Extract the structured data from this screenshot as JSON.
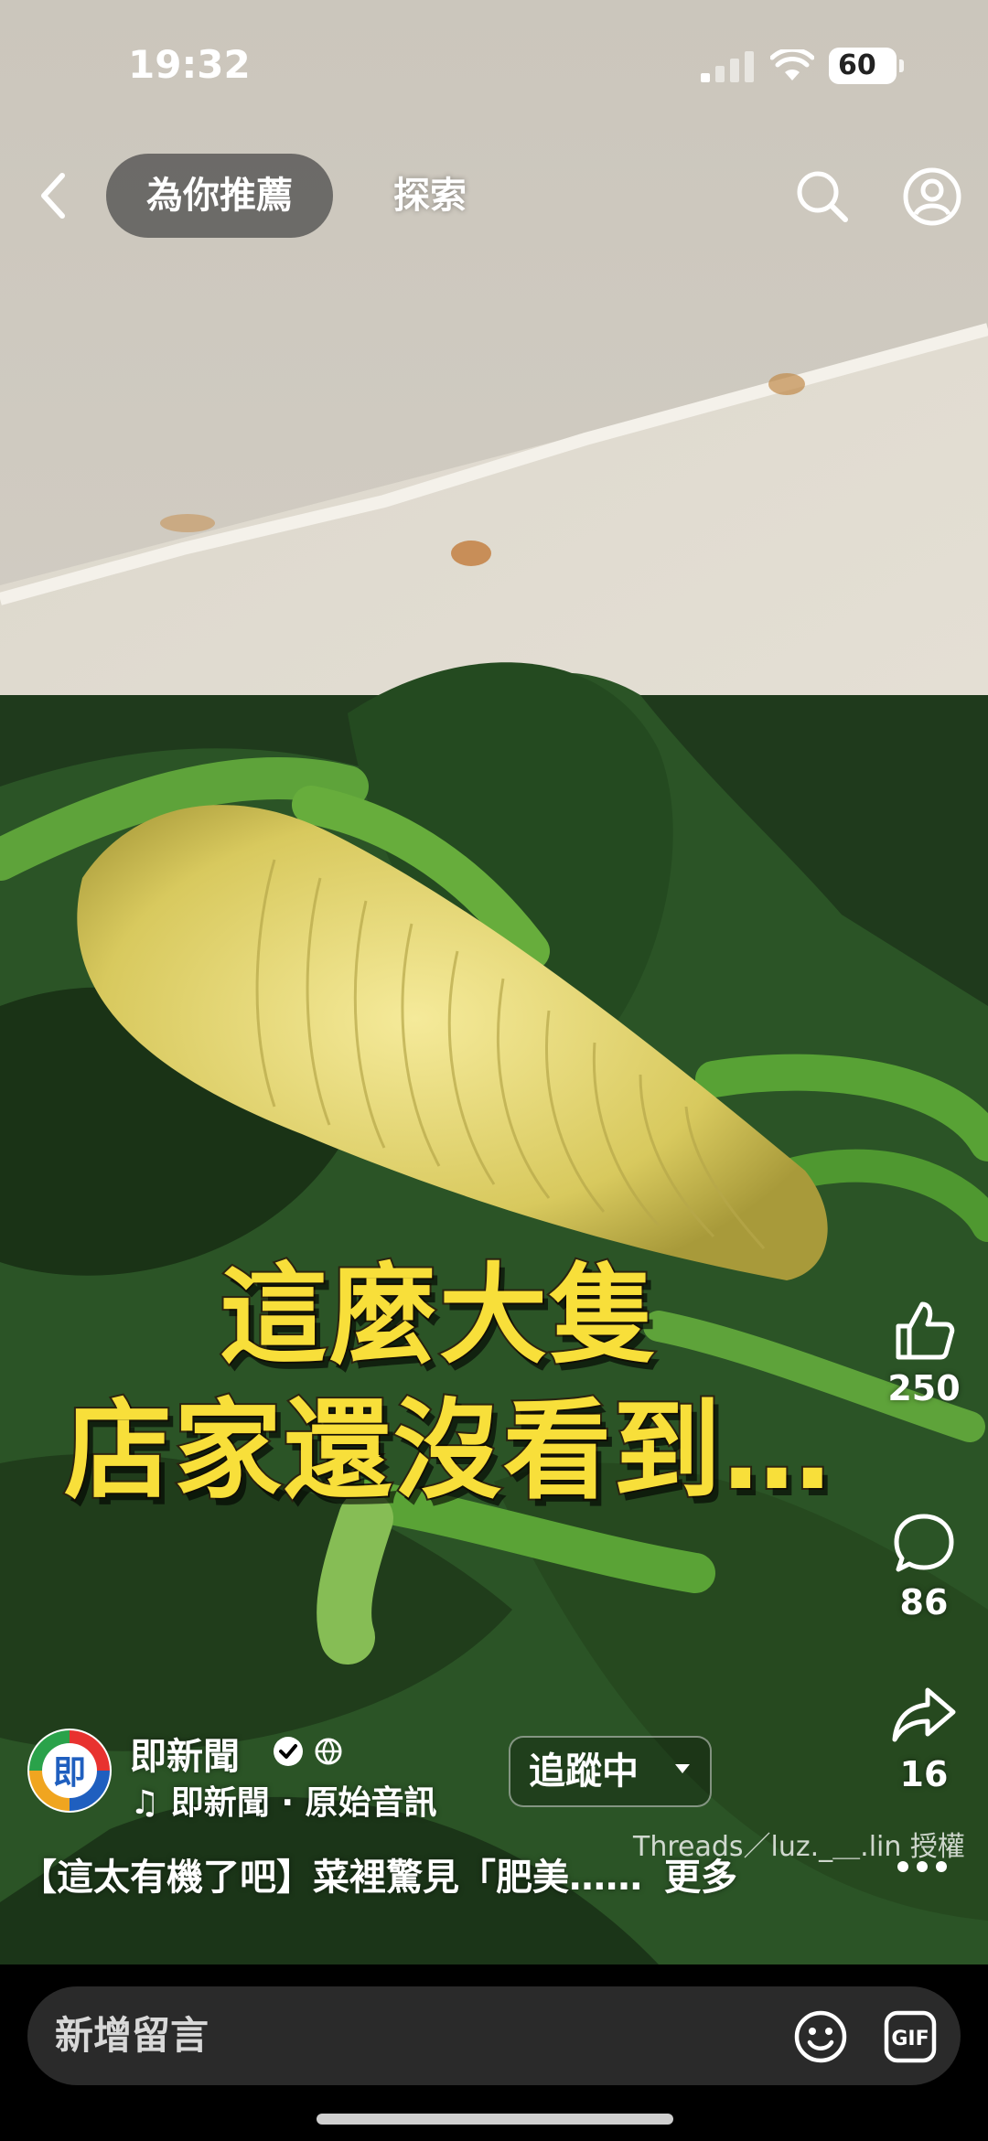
{
  "status_bar": {
    "time": "19:32",
    "battery": "60"
  },
  "nav": {
    "tab_active": "為你推薦",
    "tab_explore": "探索"
  },
  "caption": {
    "line1": "這麼大隻",
    "line2": "店家還沒看到…"
  },
  "actions": {
    "likes": "250",
    "comments": "86",
    "shares": "16"
  },
  "account": {
    "name": "即新聞",
    "avatar_text": "即",
    "audio": "♫ 即新聞 · 原始音訊",
    "follow_label": "追蹤中"
  },
  "watermark": "Threads／luz._＿.lin 授權",
  "description": {
    "text": "【這太有機了吧】菜裡驚見「肥美……",
    "more": "更多"
  },
  "bottom_bar": {
    "placeholder": "新增留言"
  },
  "colors": {
    "caption_yellow": "#f8df3a",
    "comment_bar": "#2a2a2a",
    "avatar_red": "#e8322f",
    "avatar_blue": "#1f5fbf"
  }
}
